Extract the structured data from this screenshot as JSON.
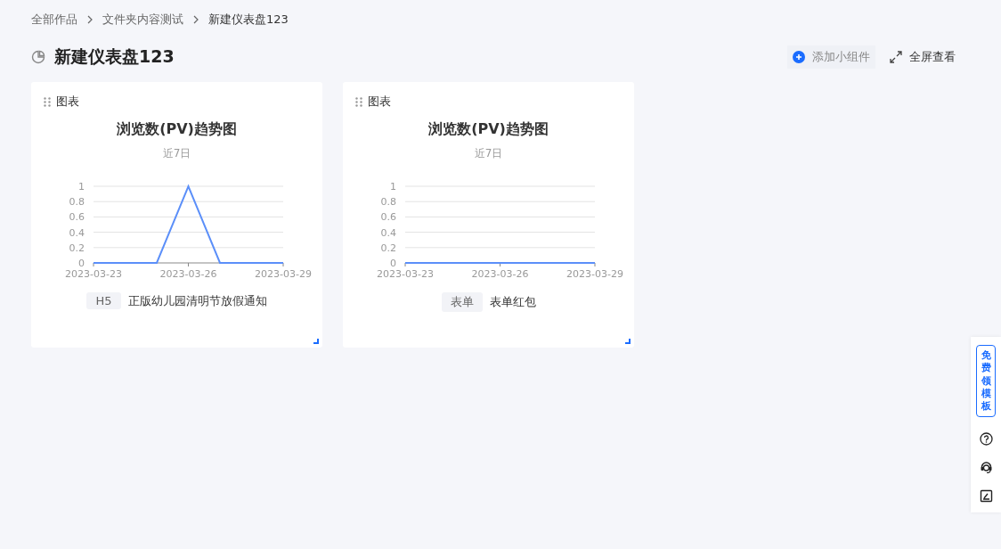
{
  "breadcrumb": [
    "全部作品",
    "文件夹内容测试",
    "新建仪表盘123"
  ],
  "title": "新建仪表盘123",
  "actions": {
    "add_widget": "添加小组件",
    "fullscreen": "全屏查看"
  },
  "cards": [
    {
      "header": "图表",
      "title": "浏览数(PV)趋势图",
      "subtitle": "近7日",
      "tag": "H5",
      "source": "正版幼儿园清明节放假通知",
      "chart_data": {
        "type": "line",
        "x": [
          "2023-03-23",
          "2023-03-24",
          "2023-03-25",
          "2023-03-26",
          "2023-03-27",
          "2023-03-28",
          "2023-03-29"
        ],
        "series": [
          {
            "color": "#5b8ff9",
            "values": [
              0,
              0,
              0,
              1,
              0,
              0,
              0
            ]
          }
        ],
        "xlim": [
          "2023-03-23",
          "2023-03-29"
        ],
        "grid": true,
        "ylim": [
          0,
          1
        ],
        "yticks": [
          0,
          0.2,
          0.4,
          0.6,
          0.8,
          1
        ],
        "xticks": [
          "2023-03-23",
          "2023-03-26",
          "2023-03-29"
        ]
      }
    },
    {
      "header": "图表",
      "title": "浏览数(PV)趋势图",
      "subtitle": "近7日",
      "tag": "表单",
      "source": "表单红包",
      "chart_data": {
        "type": "line",
        "x": [
          "2023-03-23",
          "2023-03-24",
          "2023-03-25",
          "2023-03-26",
          "2023-03-27",
          "2023-03-28",
          "2023-03-29"
        ],
        "series": [
          {
            "color": "#5b8ff9",
            "values": [
              0,
              0,
              0,
              0,
              0,
              0,
              0
            ]
          }
        ],
        "xlim": [
          "2023-03-23",
          "2023-03-29"
        ],
        "grid": true,
        "ylim": [
          0,
          1
        ],
        "yticks": [
          0,
          0.2,
          0.4,
          0.6,
          0.8,
          1
        ],
        "xticks": [
          "2023-03-23",
          "2023-03-26",
          "2023-03-29"
        ]
      }
    }
  ],
  "side_panel": {
    "promo": "免费领模板"
  }
}
